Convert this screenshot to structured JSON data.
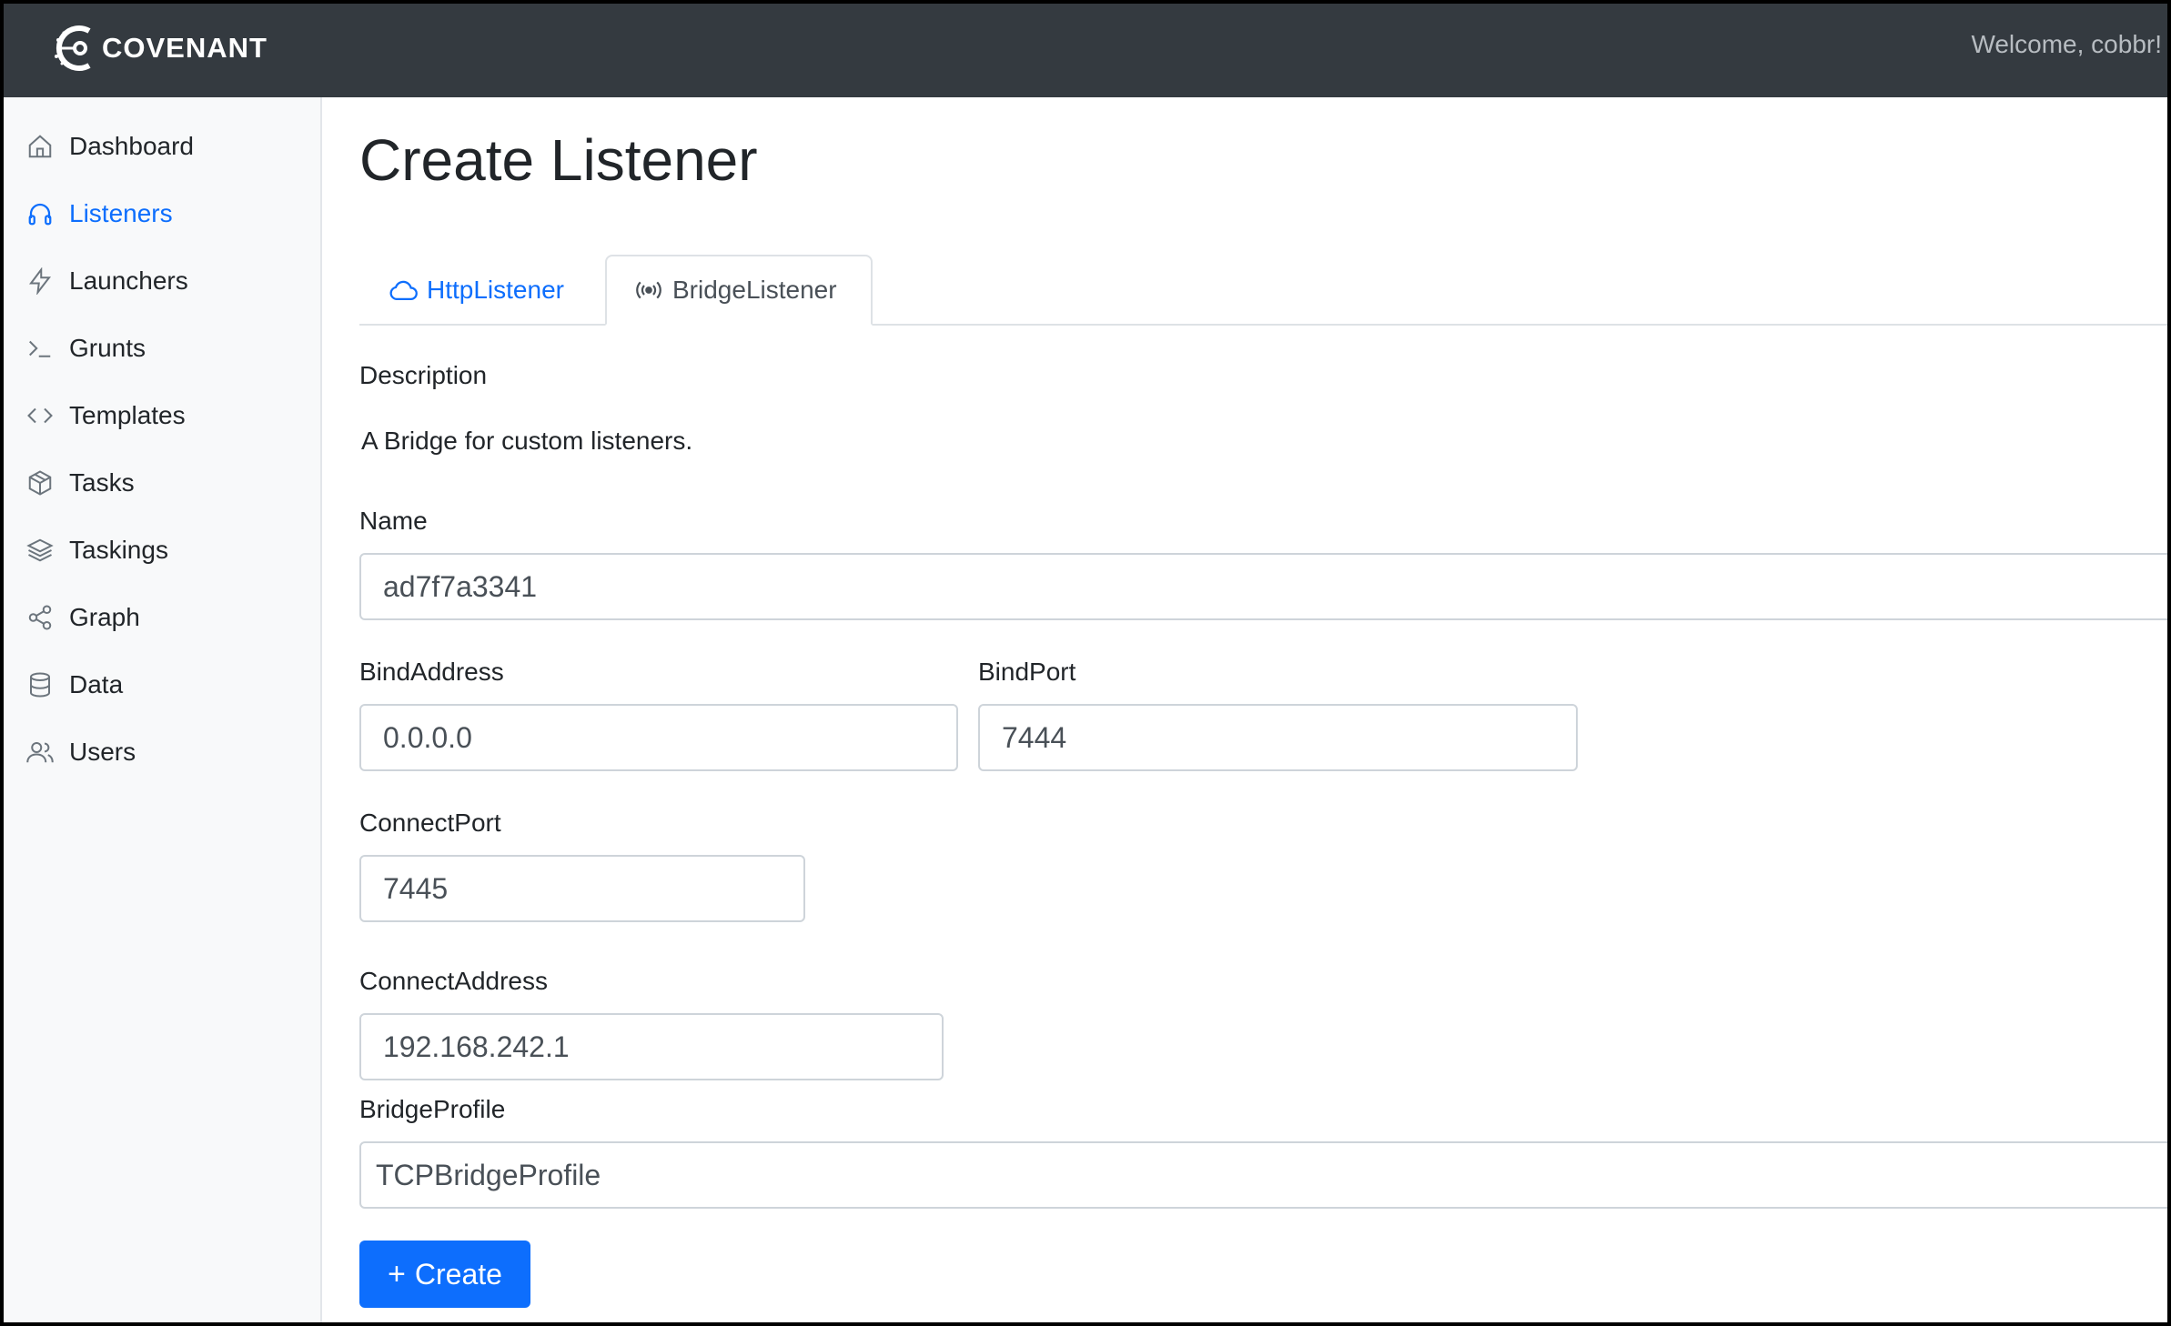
{
  "app": {
    "brand": "COVENANT",
    "welcome": "Welcome, cobbr!"
  },
  "sidebar": {
    "items": [
      {
        "label": "Dashboard",
        "icon": "home-icon"
      },
      {
        "label": "Listeners",
        "icon": "headphones-icon",
        "active": true
      },
      {
        "label": "Launchers",
        "icon": "lightning-icon"
      },
      {
        "label": "Grunts",
        "icon": "terminal-icon"
      },
      {
        "label": "Templates",
        "icon": "code-icon"
      },
      {
        "label": "Tasks",
        "icon": "box-icon"
      },
      {
        "label": "Taskings",
        "icon": "layers-icon"
      },
      {
        "label": "Graph",
        "icon": "share-icon"
      },
      {
        "label": "Data",
        "icon": "database-icon"
      },
      {
        "label": "Users",
        "icon": "users-icon"
      }
    ]
  },
  "page": {
    "title": "Create Listener",
    "tabs": [
      {
        "label": "HttpListener",
        "icon": "cloud-icon"
      },
      {
        "label": "BridgeListener",
        "icon": "broadcast-icon",
        "active": true
      }
    ]
  },
  "form": {
    "description_label": "Description",
    "description_text": "A Bridge for custom listeners.",
    "name_label": "Name",
    "name_value": "ad7f7a3341",
    "bindaddress_label": "BindAddress",
    "bindaddress_value": "0.0.0.0",
    "bindport_label": "BindPort",
    "bindport_value": "7444",
    "connectport_label": "ConnectPort",
    "connectport_value": "7445",
    "connectaddress_label": "ConnectAddress",
    "connectaddress_value": "192.168.242.1",
    "bridgeprofile_label": "BridgeProfile",
    "bridgeprofile_value": "TCPBridgeProfile",
    "create_label": "Create"
  },
  "colors": {
    "topbar": "#343a40",
    "accent": "#0d6efd",
    "sidebar_bg": "#f8f9fa"
  }
}
